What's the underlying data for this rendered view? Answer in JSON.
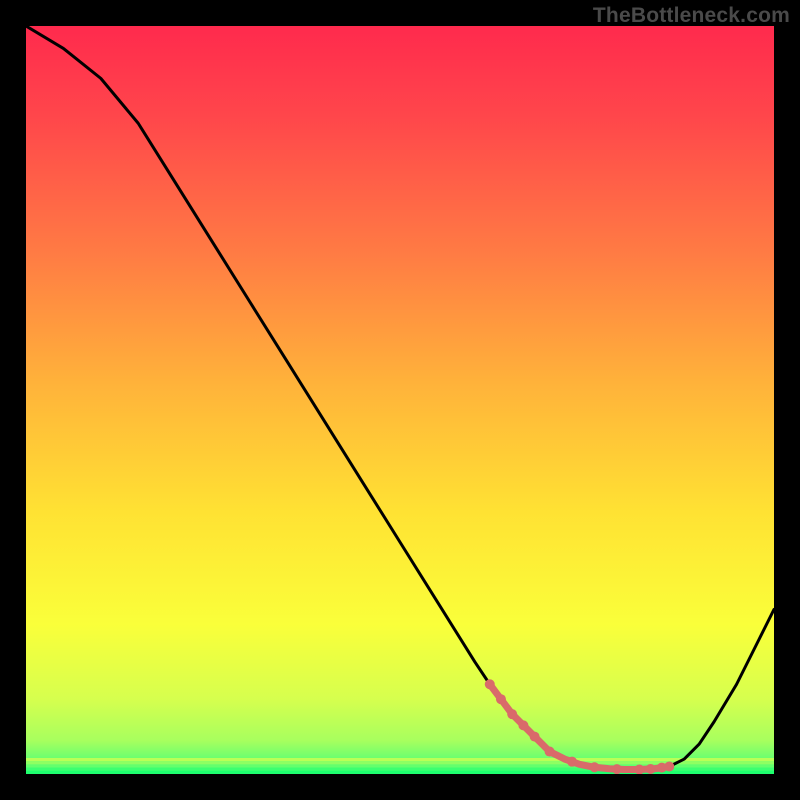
{
  "watermark": "TheBottleneck.com",
  "chart_data": {
    "type": "line",
    "title": "",
    "xlabel": "",
    "ylabel": "",
    "xlim": [
      0,
      100
    ],
    "ylim": [
      0,
      100
    ],
    "series": [
      {
        "name": "main-curve",
        "x": [
          0,
          5,
          10,
          15,
          20,
          25,
          30,
          35,
          40,
          45,
          50,
          55,
          60,
          62,
          65,
          68,
          70,
          72,
          74,
          76,
          78,
          80,
          82,
          84,
          86,
          88,
          90,
          92,
          95,
          98,
          100
        ],
        "y": [
          100,
          97,
          93,
          87,
          79,
          71,
          63,
          55,
          47,
          39,
          31,
          23,
          15,
          12,
          8,
          5,
          3,
          2,
          1.3,
          0.9,
          0.7,
          0.6,
          0.6,
          0.7,
          1.0,
          2.0,
          4.0,
          7.0,
          12,
          18,
          22
        ]
      },
      {
        "name": "highlight-range",
        "x_start": 62,
        "x_end": 86,
        "y_level": 0.9
      }
    ],
    "gradient_stops": [
      {
        "offset": 0.0,
        "color": "#ff2a4d"
      },
      {
        "offset": 0.12,
        "color": "#ff464b"
      },
      {
        "offset": 0.3,
        "color": "#ff7a44"
      },
      {
        "offset": 0.48,
        "color": "#ffb33a"
      },
      {
        "offset": 0.65,
        "color": "#ffe233"
      },
      {
        "offset": 0.8,
        "color": "#faff3a"
      },
      {
        "offset": 0.9,
        "color": "#d6ff4e"
      },
      {
        "offset": 0.955,
        "color": "#a8ff5e"
      },
      {
        "offset": 0.985,
        "color": "#5cff74"
      },
      {
        "offset": 1.0,
        "color": "#1eff6e"
      }
    ],
    "curve_color": "#000000",
    "highlight_color": "#d96a6a",
    "highlight_stroke_width": 7,
    "highlight_dot_radius": 5,
    "curve_stroke_width": 3
  }
}
